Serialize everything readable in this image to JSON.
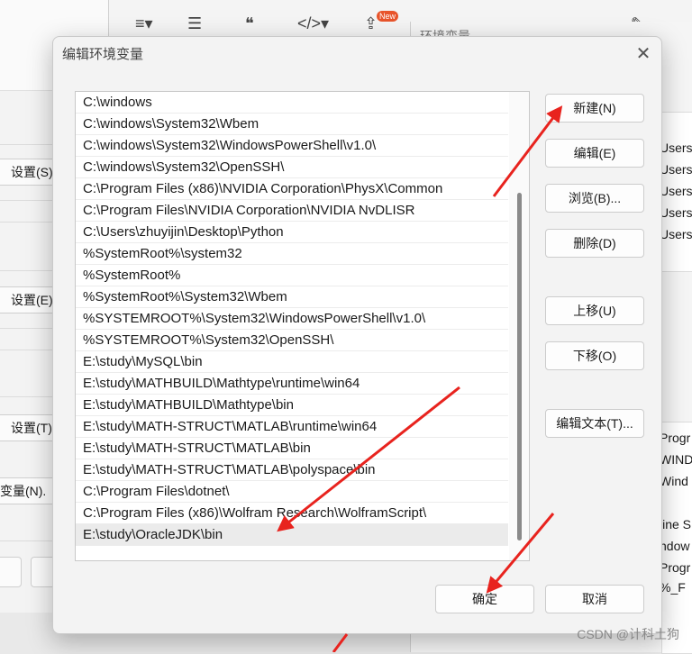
{
  "background": {
    "left_window": {
      "buttons": [
        "设置(S)",
        "设置(E)",
        "设置(T)",
        "变量(N)."
      ]
    },
    "right_window": {
      "title": "环境变量",
      "user_items": [
        "Users",
        "Users",
        "Users",
        "Users",
        "Users"
      ],
      "system_items": [
        "Progr",
        "WIND",
        "Wind",
        "line S",
        "ndow",
        "Progr",
        "%_F"
      ]
    },
    "toolbar": {
      "new_badge": "New"
    }
  },
  "dialog": {
    "title": "编辑环境变量",
    "paths": [
      "C:\\windows",
      "C:\\windows\\System32\\Wbem",
      "C:\\windows\\System32\\WindowsPowerShell\\v1.0\\",
      "C:\\windows\\System32\\OpenSSH\\",
      "C:\\Program Files (x86)\\NVIDIA Corporation\\PhysX\\Common",
      "C:\\Program Files\\NVIDIA Corporation\\NVIDIA NvDLISR",
      "C:\\Users\\zhuyijin\\Desktop\\Python",
      "%SystemRoot%\\system32",
      "%SystemRoot%",
      "%SystemRoot%\\System32\\Wbem",
      "%SYSTEMROOT%\\System32\\WindowsPowerShell\\v1.0\\",
      "%SYSTEMROOT%\\System32\\OpenSSH\\",
      "E:\\study\\MySQL\\bin",
      "E:\\study\\MATHBUILD\\Mathtype\\runtime\\win64",
      "E:\\study\\MATHBUILD\\Mathtype\\bin",
      "E:\\study\\MATH-STRUCT\\MATLAB\\runtime\\win64",
      "E:\\study\\MATH-STRUCT\\MATLAB\\bin",
      "E:\\study\\MATH-STRUCT\\MATLAB\\polyspace\\bin",
      "C:\\Program Files\\dotnet\\",
      "C:\\Program Files (x86)\\Wolfram Research\\WolframScript\\",
      "E:\\study\\OracleJDK\\bin"
    ],
    "selected_index": 20,
    "buttons": {
      "new": "新建(N)",
      "edit": "编辑(E)",
      "browse": "浏览(B)...",
      "delete": "删除(D)",
      "move_up": "上移(U)",
      "move_down": "下移(O)",
      "edit_text": "编辑文本(T)...",
      "ok": "确定",
      "cancel": "取消"
    },
    "annotation_color": "#e8231e"
  },
  "watermark": "CSDN @计科土狗"
}
